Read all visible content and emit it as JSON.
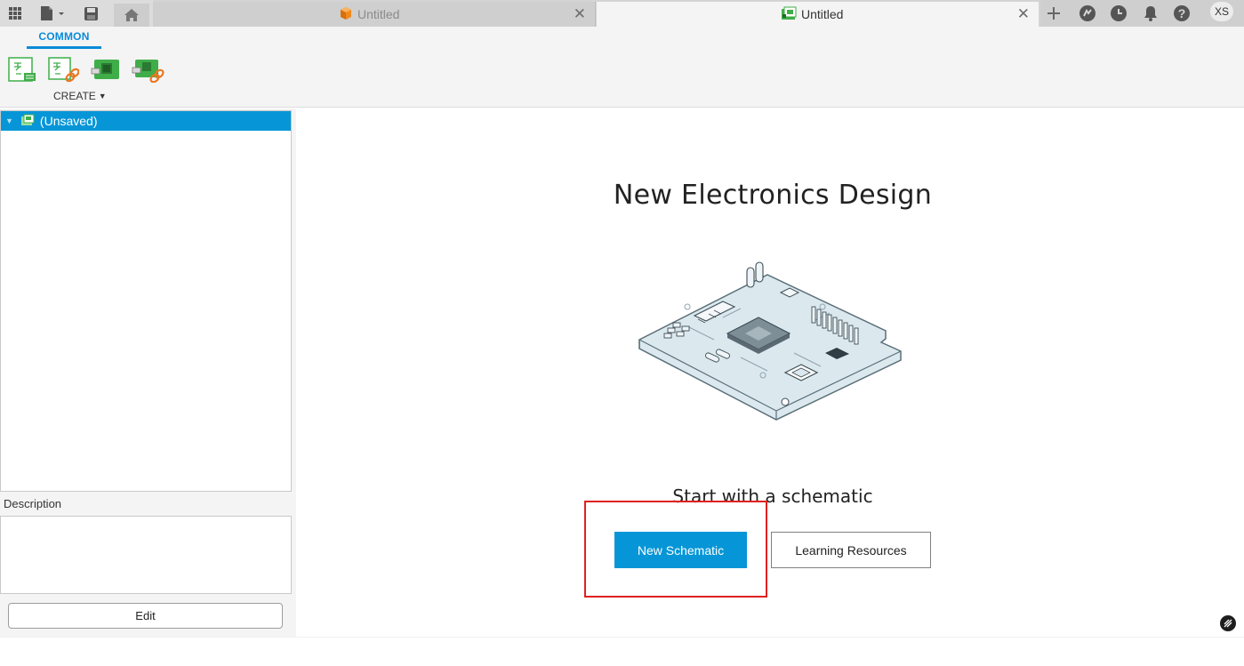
{
  "tabs": [
    {
      "label": "Untitled",
      "icon": "cube-icon",
      "active": false
    },
    {
      "label": "Untitled",
      "icon": "electronics-design-icon",
      "active": true
    }
  ],
  "header": {
    "user_initials": "XS"
  },
  "toolbar": {
    "tab_label": "COMMON",
    "create_label": "CREATE",
    "tools": [
      "new-schematic-tool",
      "link-schematic-tool",
      "new-pcb-tool",
      "link-pcb-tool"
    ]
  },
  "browser": {
    "root_item": "(Unsaved)",
    "description_label": "Description",
    "edit_label": "Edit"
  },
  "main": {
    "title": "New Electronics Design",
    "subtitle": "Start with a schematic",
    "primary_button": "New Schematic",
    "secondary_button": "Learning Resources"
  },
  "colors": {
    "accent": "#0696d7",
    "highlight": "#e02020",
    "pcb_green": "#3fae49"
  }
}
